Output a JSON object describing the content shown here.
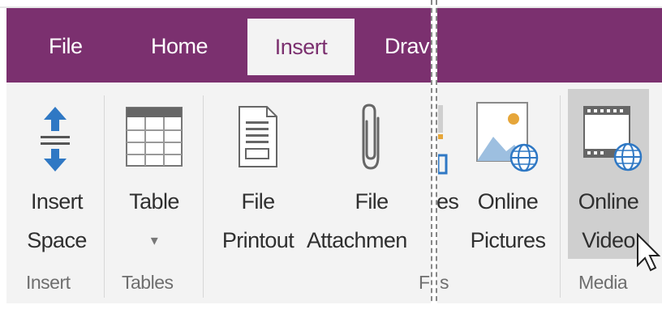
{
  "tabs": {
    "file": "File",
    "home": "Home",
    "insert": "Insert",
    "draw": "Drav"
  },
  "buttons": {
    "insert_space": {
      "line1": "Insert",
      "line2": "Space"
    },
    "table": {
      "line1": "Table",
      "dropdown": "▾"
    },
    "file_printout": {
      "line1": "File",
      "line2": "Printout"
    },
    "file_attachment": {
      "line1": "File",
      "line2": "Attachmen"
    },
    "files_partial": "es",
    "online_pictures": {
      "line1": "Online",
      "line2": "Pictures"
    },
    "online_video": {
      "line1": "Online",
      "line2": "Video"
    }
  },
  "groups": {
    "insert": "Insert",
    "tables": "Tables",
    "files": "F",
    "files_tail": "s",
    "media": "Media"
  },
  "colors": {
    "tab_bar": "#7b306f",
    "ribbon": "#f3f3f3",
    "hover": "#cfcfcf",
    "icon_blue": "#2f78c4"
  }
}
